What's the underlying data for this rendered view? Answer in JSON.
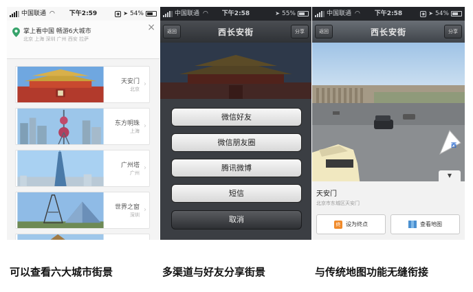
{
  "screen1": {
    "status": {
      "carrier": "中国联通",
      "time": "下午2:59",
      "battery": "54%"
    },
    "header": {
      "title": "掌上看中国 畅游6大城市",
      "subtitle": "北京 上海 深圳 广州 西安 拉萨"
    },
    "close_icon": "×",
    "cities": [
      {
        "name": "天安门",
        "city": "北京"
      },
      {
        "name": "东方明珠",
        "city": "上海"
      },
      {
        "name": "广州塔",
        "city": "广州"
      },
      {
        "name": "世界之窗",
        "city": "深圳"
      }
    ],
    "chevron": "›"
  },
  "screen2": {
    "status": {
      "carrier": "中国联通",
      "time": "下午2:58",
      "battery": "55%"
    },
    "nav": {
      "back": "返回",
      "title": "西长安街",
      "share": "分享"
    },
    "share_options": [
      "微信好友",
      "微信朋友圈",
      "腾讯微博",
      "短信"
    ],
    "cancel": "取消"
  },
  "screen3": {
    "status": {
      "carrier": "中国联通",
      "time": "下午2:58",
      "battery": "54%"
    },
    "nav": {
      "back": "返回",
      "title": "西长安街",
      "share": "分享"
    },
    "compass_label": "西",
    "place_name": "天安门",
    "place_address": "北京市东城区天安门",
    "endpoint_icon": "终",
    "set_endpoint": "设为终点",
    "view_map": "查看地图"
  },
  "captions": [
    "可以查看六大城市街景",
    "多渠道与好友分享街景",
    "与传统地图功能无缝衔接"
  ],
  "colors": {
    "accent_orange": "#f08a2a",
    "map_blue": "#4a90d0",
    "dark_sheet": "#3b3e43"
  }
}
